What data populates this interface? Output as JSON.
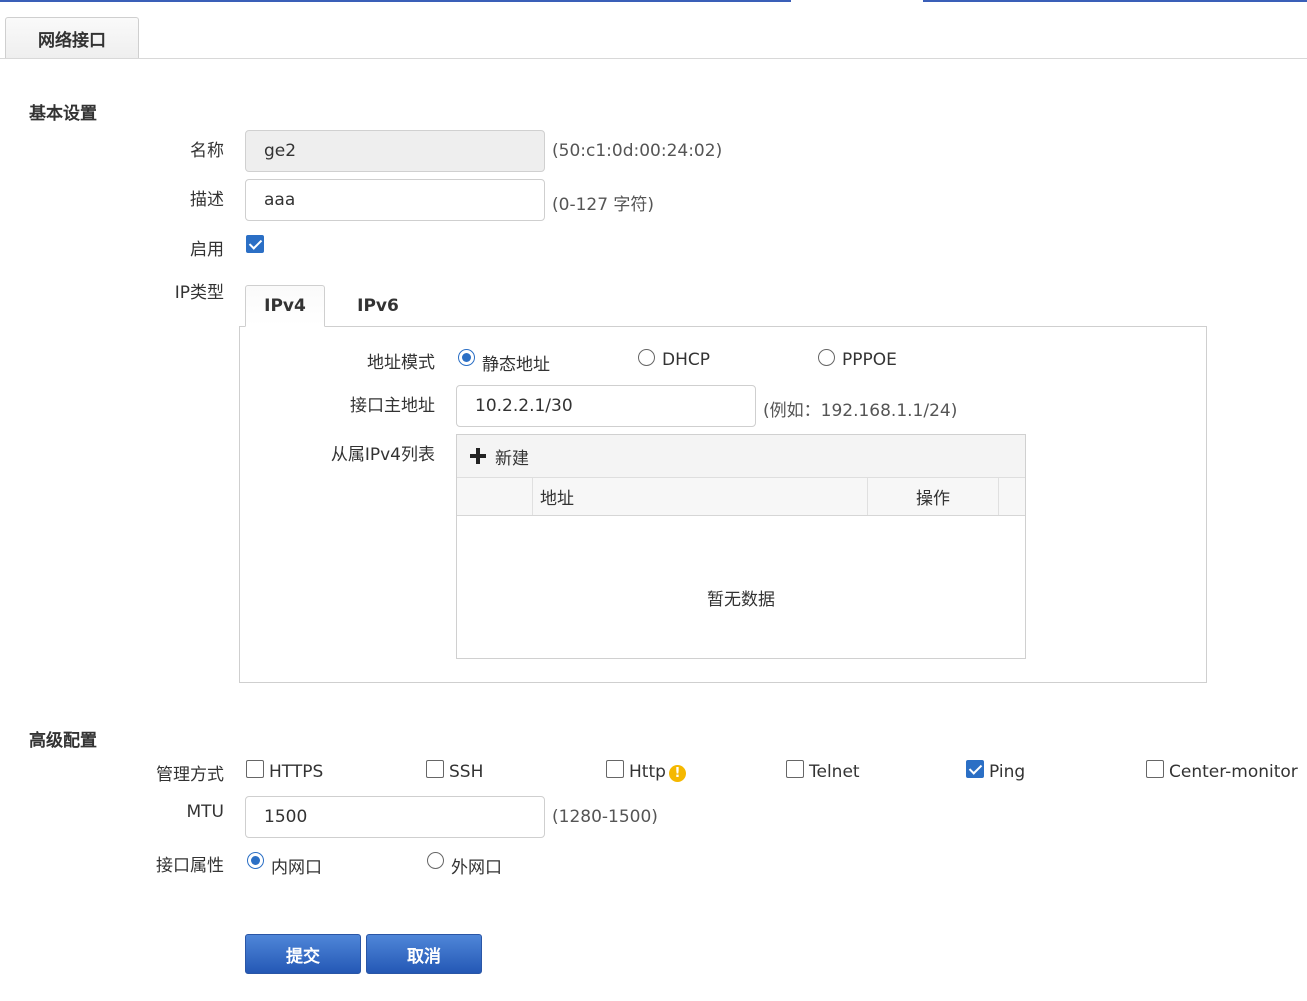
{
  "tab": {
    "label": "网络接口"
  },
  "basic": {
    "title": "基本设置",
    "name_label": "名称",
    "name_value": "ge2",
    "name_hint": "(50:c1:0d:00:24:02)",
    "desc_label": "描述",
    "desc_value": "aaa",
    "desc_hint": "(0-127 字符)",
    "enable_label": "启用",
    "enable_checked": true,
    "iptype_label": "IP类型",
    "ip_tabs": [
      "IPv4",
      "IPv6"
    ],
    "ip_active_tab": "IPv4"
  },
  "ipv4": {
    "mode_label": "地址模式",
    "modes": [
      "静态地址",
      "DHCP",
      "PPPOE"
    ],
    "selected_mode": "静态地址",
    "primary_label": "接口主地址",
    "primary_value": "10.2.2.1/30",
    "primary_hint": "(例如：192.168.1.1/24)",
    "secondary_label": "从属IPv4列表",
    "add_label": "新建",
    "columns": [
      "地址",
      "操作"
    ],
    "empty_text": "暂无数据"
  },
  "advanced": {
    "title": "高级配置",
    "mgmt_label": "管理方式",
    "mgmt_options": [
      {
        "label": "HTTPS",
        "checked": false
      },
      {
        "label": "SSH",
        "checked": false
      },
      {
        "label": "Http",
        "checked": false
      },
      {
        "label": "Telnet",
        "checked": false
      },
      {
        "label": "Ping",
        "checked": true
      },
      {
        "label": "Center-monitor",
        "checked": false
      }
    ],
    "mtu_label": "MTU",
    "mtu_value": "1500",
    "mtu_hint": "(1280-1500)",
    "attr_label": "接口属性",
    "attr_options": [
      "内网口",
      "外网口"
    ],
    "attr_selected": "内网口"
  },
  "buttons": {
    "submit": "提交",
    "cancel": "取消"
  },
  "colors": {
    "accent": "#2b6fc5",
    "button": "#3a6fc8",
    "warning": "#f5b800"
  },
  "icons": {
    "add": "plus-icon",
    "http_note": "info-icon"
  }
}
